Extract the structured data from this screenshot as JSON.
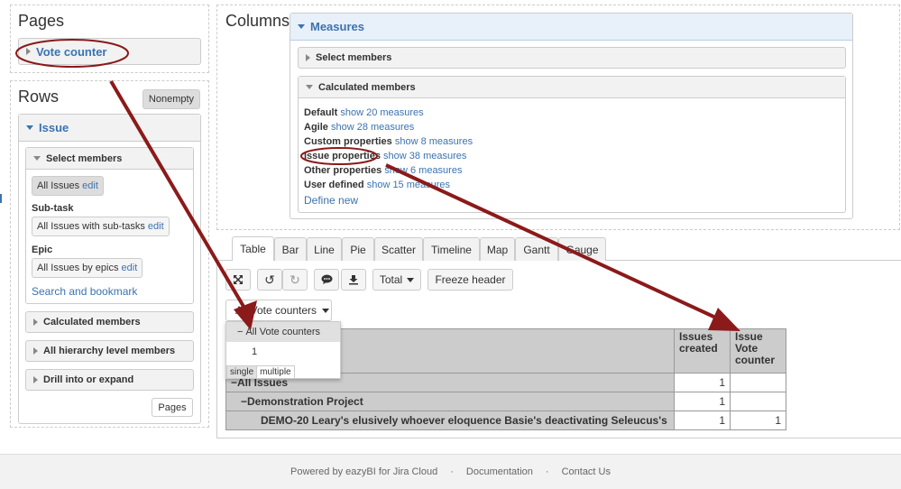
{
  "pages": {
    "title": "Pages",
    "item": "Vote counter"
  },
  "rows": {
    "title": "Rows",
    "nonempty_label": "Nonempty",
    "dimension": "Issue",
    "select_members": "Select members",
    "all_issues": "All Issues",
    "edit": "edit",
    "subtask_label": "Sub-task",
    "subtask_value": "All Issues with sub-tasks",
    "epic_label": "Epic",
    "epic_value": "All Issues by epics",
    "search_bookmark": "Search and bookmark",
    "calculated_members": "Calculated members",
    "hierarchy_members": "All hierarchy level members",
    "drill": "Drill into or expand",
    "pages_button": "Pages"
  },
  "columns": {
    "title": "Columns",
    "measures": "Measures",
    "select_members": "Select members",
    "calculated_members": "Calculated members",
    "groups": [
      {
        "name": "Default",
        "link": "show 20 measures"
      },
      {
        "name": "Agile",
        "link": "show 28 measures"
      },
      {
        "name": "Custom properties",
        "link": "show 8 measures"
      },
      {
        "name": "Issue properties",
        "link": "show 38 measures"
      },
      {
        "name": "Other properties",
        "link": "show 6 measures"
      },
      {
        "name": "User defined",
        "link": "show 15 measures"
      }
    ],
    "define_new": "Define new"
  },
  "tabs": [
    "Table",
    "Bar",
    "Line",
    "Pie",
    "Scatter",
    "Timeline",
    "Map",
    "Gantt",
    "Gauge"
  ],
  "toolbar": {
    "total": "Total",
    "freeze": "Freeze header"
  },
  "page_filter": {
    "label": "All Vote counters",
    "options": [
      "All Vote counters",
      "1"
    ],
    "mode_single": "single",
    "mode_multiple": "multiple"
  },
  "table": {
    "headers": [
      "Issues created",
      "Issue Vote counter"
    ],
    "rows": [
      {
        "label": "All Issues",
        "created": "1",
        "vote": ""
      },
      {
        "label": "Demonstration Project",
        "created": "1",
        "vote": ""
      },
      {
        "label": "DEMO-20 Leary's elusively whoever eloquence Basie's deactivating Seleucus's",
        "created": "1",
        "vote": "1"
      }
    ]
  },
  "footer": {
    "powered": "Powered by eazyBI for Jira Cloud",
    "sep": "·",
    "docs": "Documentation",
    "contact": "Contact Us"
  },
  "colors": {
    "link": "#3b73af",
    "annotation": "#8b0000"
  }
}
